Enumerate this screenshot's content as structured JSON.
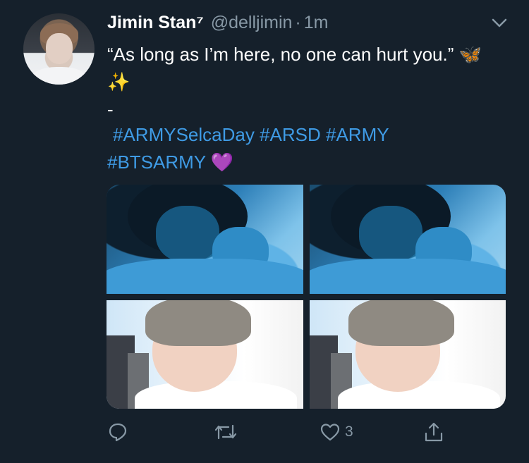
{
  "tweet": {
    "display_name": "Jimin Stan⁷",
    "handle": "@delljimin",
    "separator": "·",
    "time": "1m",
    "text": "“As long as I’m here, no one can hurt you.” 🦋 ✨",
    "dash": "-",
    "hashtags_line1": "#ARMYSelcaDay #ARSD #ARMY",
    "hashtags_line2": "#BTSARMY 💜",
    "like_count": "3"
  },
  "icons": {
    "caret": "chevron-down-icon",
    "reply": "reply-icon",
    "retweet": "retweet-icon",
    "like": "heart-icon",
    "share": "share-icon"
  },
  "colors": {
    "background": "#15202b",
    "text_primary": "#ffffff",
    "text_secondary": "#8899a6",
    "link": "#3f9be5"
  }
}
